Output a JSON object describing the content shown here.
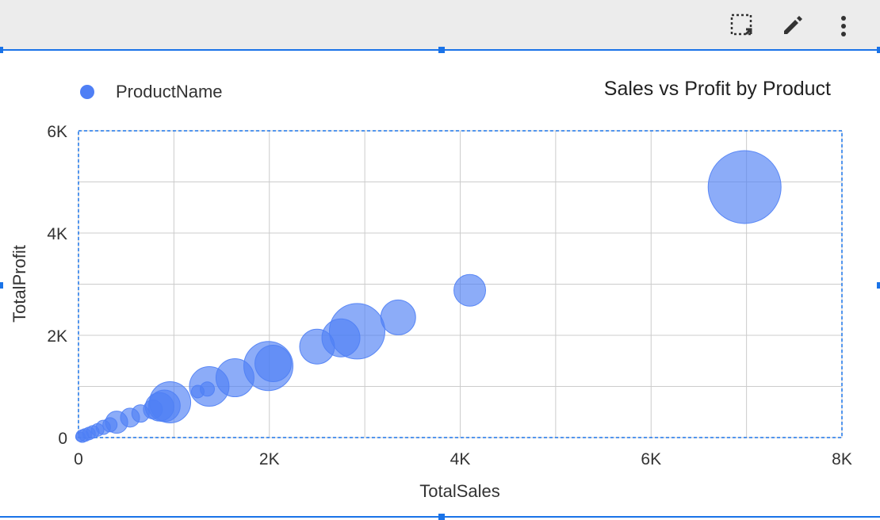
{
  "toolbar": {
    "items": [
      {
        "name": "select-area-icon",
        "label": "Select area"
      },
      {
        "name": "edit-icon",
        "label": "Edit"
      },
      {
        "name": "more-icon",
        "label": "More options"
      }
    ]
  },
  "colors": {
    "accent": "#1a73e8",
    "bubble": "#4f7ff5",
    "grid": "#cccccc",
    "toolbar_bg": "#ececec",
    "text": "#333333"
  },
  "chart_data": {
    "type": "scatter",
    "title": "Sales vs Profit by Product",
    "xlabel": "TotalSales",
    "ylabel": "TotalProfit",
    "xlim": [
      0,
      8000
    ],
    "ylim": [
      0,
      6000
    ],
    "x_ticks": [
      "0",
      "2K",
      "4K",
      "6K",
      "8K"
    ],
    "y_ticks": [
      "0",
      "2K",
      "4K",
      "6K"
    ],
    "grid": true,
    "legend": {
      "position": "top-left",
      "entries": [
        "ProductName"
      ]
    },
    "series": [
      {
        "name": "ProductName",
        "points": [
          {
            "x": 6980,
            "y": 4900,
            "size": 46
          },
          {
            "x": 4100,
            "y": 2880,
            "size": 20
          },
          {
            "x": 3350,
            "y": 2350,
            "size": 22
          },
          {
            "x": 2920,
            "y": 2080,
            "size": 35
          },
          {
            "x": 2750,
            "y": 1950,
            "size": 24
          },
          {
            "x": 2500,
            "y": 1780,
            "size": 22
          },
          {
            "x": 2040,
            "y": 1450,
            "size": 23
          },
          {
            "x": 1990,
            "y": 1400,
            "size": 31
          },
          {
            "x": 1640,
            "y": 1170,
            "size": 24
          },
          {
            "x": 1370,
            "y": 1000,
            "size": 25
          },
          {
            "x": 1350,
            "y": 950,
            "size": 9
          },
          {
            "x": 1250,
            "y": 900,
            "size": 8
          },
          {
            "x": 960,
            "y": 690,
            "size": 26
          },
          {
            "x": 900,
            "y": 620,
            "size": 20
          },
          {
            "x": 850,
            "y": 600,
            "size": 18
          },
          {
            "x": 780,
            "y": 550,
            "size": 12
          },
          {
            "x": 650,
            "y": 470,
            "size": 11
          },
          {
            "x": 540,
            "y": 390,
            "size": 12
          },
          {
            "x": 400,
            "y": 300,
            "size": 14
          },
          {
            "x": 330,
            "y": 250,
            "size": 9
          },
          {
            "x": 260,
            "y": 200,
            "size": 9
          },
          {
            "x": 200,
            "y": 150,
            "size": 8
          },
          {
            "x": 150,
            "y": 110,
            "size": 8
          },
          {
            "x": 110,
            "y": 80,
            "size": 8
          },
          {
            "x": 70,
            "y": 50,
            "size": 8
          },
          {
            "x": 40,
            "y": 30,
            "size": 8
          },
          {
            "x": 20,
            "y": 15,
            "size": 6
          }
        ]
      }
    ]
  }
}
